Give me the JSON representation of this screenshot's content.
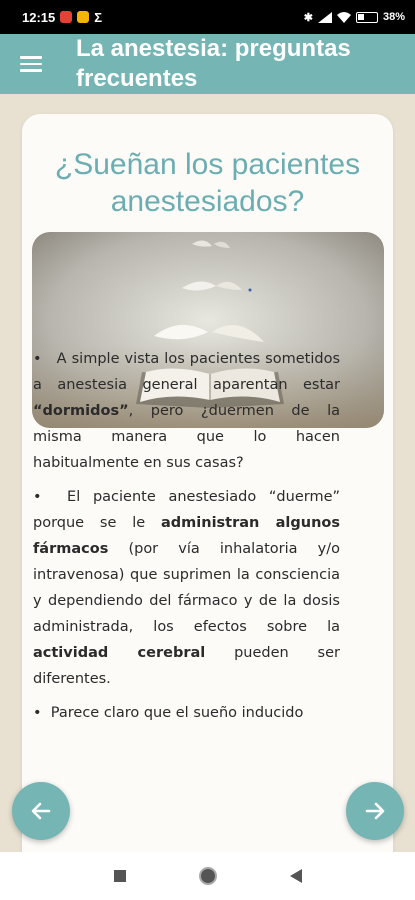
{
  "status_bar": {
    "time": "12:15",
    "extra_icon": "Σ",
    "battery": "38%"
  },
  "app_bar": {
    "title_line1": "La anestesia: preguntas",
    "title_line2": "frecuentes",
    "menu_icon": "hamburger-icon"
  },
  "card": {
    "question": "¿Sueñan los pacientes anestesiados?",
    "image_alt": "open-book-with-flying-pages",
    "paragraphs": [
      {
        "bullet": "•",
        "pre": "A simple vista los pacientes sometidos a anestesia general aparentan estar ",
        "bold": "“dormidos”",
        "post": ", pero ¿duermen de la misma manera que lo hacen habitualmente en sus casas?"
      },
      {
        "bullet": "•",
        "pre": "El paciente anestesiado “duerme” porque se le ",
        "bold": "administran algunos fármacos",
        "mid": " (por vía inhalatoria y/o intravenosa) que suprimen la consciencia y dependiendo del fármaco y de la dosis administrada, los efectos sobre la ",
        "bold2": "actividad cerebral",
        "post": " pueden ser diferentes."
      },
      {
        "bullet": "•",
        "pre": "Parece claro que el sueño inducido"
      }
    ]
  },
  "colors": {
    "accent": "#75b5b4",
    "title": "#6cadb1",
    "background": "#e8e1d1",
    "card": "#fcfbf8"
  },
  "nav": {
    "back_icon": "previous-arrow-icon",
    "next_icon": "next-arrow-icon",
    "system_back": "triangle-back-icon",
    "system_home": "circle-home-icon",
    "system_recents": "square-recents-icon"
  }
}
